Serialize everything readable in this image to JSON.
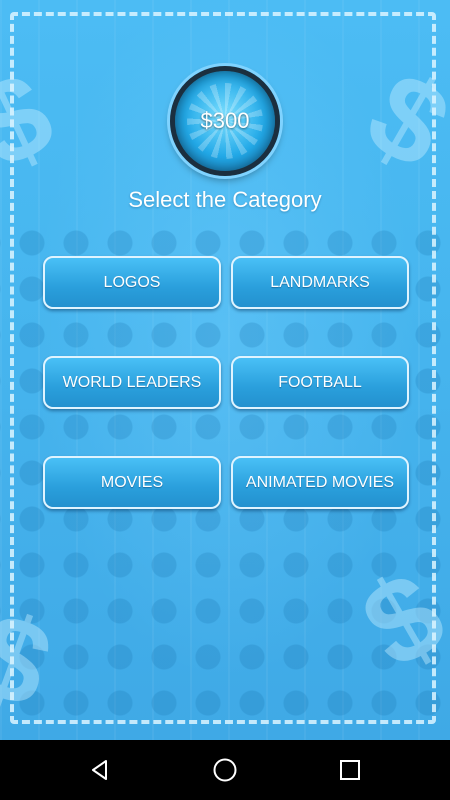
{
  "balance": {
    "amount": "$300"
  },
  "heading": "Select the Category",
  "categories": [
    {
      "label": "LOGOS"
    },
    {
      "label": "LANDMARKS"
    },
    {
      "label": "WORLD LEADERS"
    },
    {
      "label": "FOOTBALL"
    },
    {
      "label": "MOVIES"
    },
    {
      "label": "ANIMATED MOVIES"
    }
  ],
  "colors": {
    "background": "#47b6ef",
    "button": "#2a9fdc",
    "text": "#ffffff",
    "navbar": "#000000"
  },
  "navbar": {
    "icons": [
      "back-icon",
      "home-icon",
      "recents-icon"
    ]
  }
}
